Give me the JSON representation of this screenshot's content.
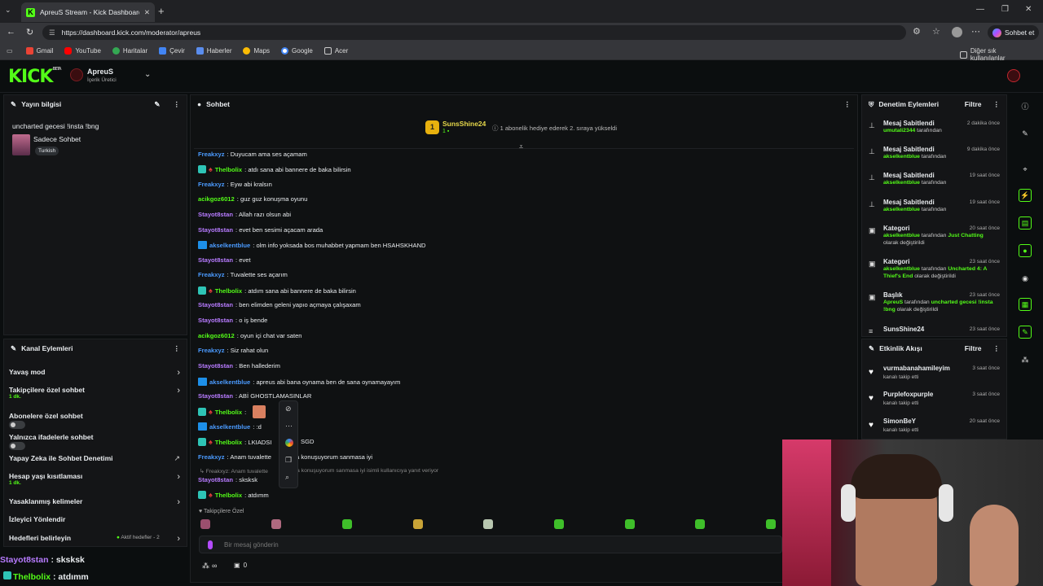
{
  "browser": {
    "tab_title": "ApreuS Stream - Kick Dashboard",
    "url": "https://dashboard.kick.com/moderator/apreus",
    "profile_button": "Sohbet et",
    "bookmarks": [
      "Gmail",
      "YouTube",
      "Haritalar",
      "Çevir",
      "Haberler",
      "Maps",
      "Google",
      "Acer"
    ],
    "other_bookmarks": "Diğer sık kullanılanlar"
  },
  "header": {
    "logo": "KICK",
    "logo_tag": "BETA",
    "channel_name": "ApreuS",
    "channel_role": "İçerik Üretici"
  },
  "stream_info": {
    "title": "Yayın bilgisi",
    "stream_title": "uncharted gecesi !insta !bng",
    "category": "Sadece Sohbet",
    "language": "Turkish"
  },
  "channel_actions": {
    "title": "Kanal Eylemleri",
    "items": [
      {
        "label": "Yavaş mod",
        "sub": ""
      },
      {
        "label": "Takipçilere özel sohbet",
        "sub": "1 dk."
      },
      {
        "label": "Abonelere özel sohbet",
        "sub": ""
      },
      {
        "label": "Yalnızca ifadelerle sohbet",
        "sub": ""
      },
      {
        "label": "Yapay Zeka ile Sohbet Denetimi",
        "sub": ""
      },
      {
        "label": "Hesap yaşı kısıtlaması",
        "sub": "1 dk."
      },
      {
        "label": "Yasaklanmış kelimeler",
        "sub": ""
      },
      {
        "label": "İzleyici Yönlendir",
        "sub": ""
      },
      {
        "label": "Hedefleri belirleyin",
        "sub": ""
      }
    ],
    "goals_status": "Aktif hedefler - 2"
  },
  "overlay_chat": [
    {
      "user": "Stayot8stan",
      "text": " : sksksk"
    },
    {
      "user": "Thelbolix",
      "text": " : atdımm"
    }
  ],
  "chat": {
    "title": "Sohbet",
    "pinned": {
      "user": "SunsShine24",
      "count": "1",
      "event": "1 abonelik hediye ederek 2. sıraya yükseldi"
    },
    "messages": [
      {
        "user": "Freakxyz",
        "color": "blue",
        "badges": "",
        "text": ": Duyucam ama ses açamam"
      },
      {
        "user": "Thelbolix",
        "color": "green",
        "badges": "tr",
        "text": ": atdı sana abi bannere de baka bilirsin"
      },
      {
        "user": "Freakxyz",
        "color": "blue",
        "badges": "",
        "text": ": Eyw abi kralsın"
      },
      {
        "user": "acikgoz6012",
        "color": "green",
        "badges": "",
        "text": ": guz guz konuşma oyunu"
      },
      {
        "user": "Stayot8stan",
        "color": "purple",
        "badges": "",
        "text": ": Allah razı olsun abi"
      },
      {
        "user": "Stayot8stan",
        "color": "purple",
        "badges": "",
        "text": ": evet ben sesimi açacam arada"
      },
      {
        "user": "akselkentblue",
        "color": "blue",
        "badges": "m",
        "text": ": olm info yoksada bos muhabbet yapmam ben HSAHSKHAND"
      },
      {
        "user": "Stayot8stan",
        "color": "purple",
        "badges": "",
        "text": ": evet"
      },
      {
        "user": "Freakxyz",
        "color": "blue",
        "badges": "",
        "text": ": Tuvalette ses açarım"
      },
      {
        "user": "Thelbolix",
        "color": "green",
        "badges": "tr",
        "text": ": atdım sana abi bannere de baka bilirsin"
      },
      {
        "user": "Stayot8stan",
        "color": "purple",
        "badges": "",
        "text": ": ben elimden geleni yapıo açmaya çalışaxam"
      },
      {
        "user": "Stayot8stan",
        "color": "purple",
        "badges": "",
        "text": ": o iş bende"
      },
      {
        "user": "acikgoz6012",
        "color": "green",
        "badges": "",
        "text": ": oyun içi chat var saten"
      },
      {
        "user": "Freakxyz",
        "color": "blue",
        "badges": "",
        "text": ": Siz rahat olun"
      },
      {
        "user": "Stayot8stan",
        "color": "purple",
        "badges": "",
        "text": ": Ben hallederim"
      },
      {
        "user": "akselkentblue",
        "color": "blue",
        "badges": "m",
        "text": ": apreus abi bana oynama ben de sana oynamayayım"
      },
      {
        "user": "Stayot8stan",
        "color": "purple",
        "badges": "",
        "text": ": ABİ GHOSTLAMASINLAR"
      },
      {
        "user": "Thelbolix",
        "color": "green",
        "badges": "tr",
        "text": ":"
      },
      {
        "user": "akselkentblue",
        "color": "blue",
        "badges": "m",
        "text": ": :d"
      },
      {
        "user": "Thelbolix",
        "color": "green",
        "badges": "tr",
        "text": ": LKIADSI"
      },
      {
        "user": "Freakxyz",
        "color": "blue",
        "badges": "",
        "text": ": Anam tuvalette"
      }
    ],
    "msg_tail_1": "SGD",
    "msg_tail_2": "a konuşuyorum sanmasa iyi",
    "reply_preview": "↳ Freakxyz: Anam tuvalette",
    "reply_tail": "a konuşuyorum sanmasa iyi isimli kullanıcıya yanıt veriyor",
    "last_messages": [
      {
        "user": "Stayot8stan",
        "text": ": sksksk"
      },
      {
        "user": "Thelbolix",
        "text": ": atdımm"
      }
    ],
    "followers_label": "Takipçilere Özel",
    "input_placeholder": "Bir mesaj gönderin",
    "footer_infinity": "∞",
    "footer_count": "0"
  },
  "mod_actions": {
    "title": "Denetim Eylemleri",
    "filter": "Filtre",
    "items": [
      {
        "title": "Mesaj Sabitlendi",
        "by": "umutali2344",
        "suffix": " tarafından",
        "time": "2 dakika önce",
        "extra": ""
      },
      {
        "title": "Mesaj Sabitlendi",
        "by": "akselkentblue",
        "suffix": " tarafından",
        "time": "9 dakika önce",
        "extra": ""
      },
      {
        "title": "Mesaj Sabitlendi",
        "by": "akselkentblue",
        "suffix": " tarafından",
        "time": "19 saat önce",
        "extra": ""
      },
      {
        "title": "Mesaj Sabitlendi",
        "by": "akselkentblue",
        "suffix": " tarafından",
        "time": "19 saat önce",
        "extra": ""
      },
      {
        "title": "Kategori",
        "by": "akselkentblue",
        "suffix": " tarafından ",
        "hl": "Just Chatting",
        "time": "20 saat önce",
        "extra": "olarak değiştirildi"
      },
      {
        "title": "Kategori",
        "by": "akselkentblue",
        "suffix": " tarafından ",
        "hl": "Uncharted 4: A Thief's End",
        "time": "23 saat önce",
        "extra": "olarak değiştirildi"
      },
      {
        "title": "Başlık",
        "by": "ApreuS",
        "suffix": " tarafından ",
        "hl": "uncharted gecesi !insta !bng",
        "time": "23 saat önce",
        "extra": "olarak değiştirildi"
      },
      {
        "title": "SunsShine24",
        "by": "",
        "suffix": "",
        "time": "23 saat önce",
        "extra": ""
      }
    ]
  },
  "activity": {
    "title": "Etkinlik Akışı",
    "filter": "Filtre",
    "items": [
      {
        "user": "vurmabanahamileyim",
        "text": "kanalı takip etti",
        "time": "3 saat önce"
      },
      {
        "user": "Purplefoxpurple",
        "text": "kanalı takip etti",
        "time": "3 saat önce"
      },
      {
        "user": "SimonBeY",
        "text": "kanalı takip etti",
        "time": "20 saat önce"
      }
    ]
  },
  "colors": {
    "accent": "#53fc18",
    "panel": "#141517",
    "bg": "#0b0e0f"
  }
}
